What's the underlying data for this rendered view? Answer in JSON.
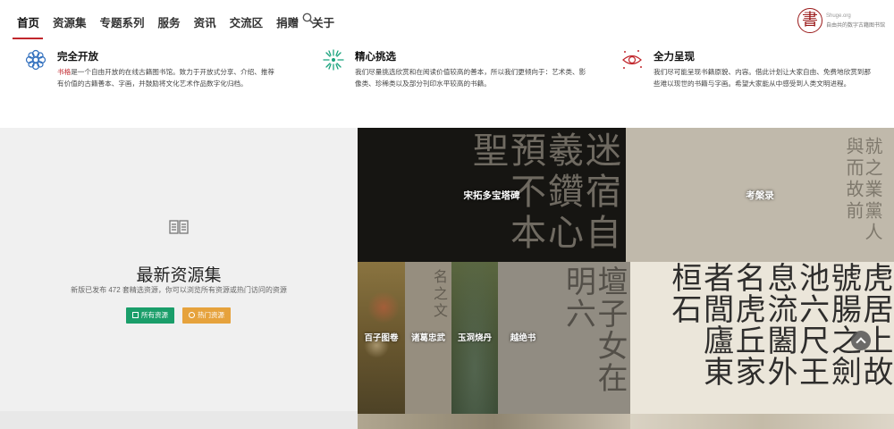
{
  "nav": {
    "items": [
      "首页",
      "资源集",
      "专题系列",
      "服务",
      "资讯",
      "交流区",
      "捐赠",
      "关于"
    ],
    "active_index": 0
  },
  "logo": {
    "seal": "書",
    "line1": "Shuge.org",
    "line2": "自由共的数字古籍图书馆"
  },
  "features": [
    {
      "title": "完全开放",
      "brand": "书格",
      "desc": "是一个自由开放的在线古籍图书馆。致力于开放式分享、介绍、推荐有价值的古籍善本、字画，并鼓励将文化艺术作品数字化归档。",
      "icon": "flower-icon",
      "color": "#2f6ebd"
    },
    {
      "title": "精心挑选",
      "desc": "我们尽量挑选欣赏和在阅读价值较高的善本，所以我们更倾向于：艺术类、影像类、珍稀类以及部分刊印水平较高的书籍。",
      "icon": "burst-icon",
      "color": "#19a37d"
    },
    {
      "title": "全力呈现",
      "desc": "我们尽可能呈现书籍原貌、内容。借此计划让大家自由、免费地欣赏到那些难以现世的书籍与字画。希望大家能从中感受到人类文明进程。",
      "icon": "eye-icon",
      "color": "#c1272d"
    }
  ],
  "latest": {
    "title": "最新资源集",
    "subtitle": "新版已发布 472 套精选资源，你可以浏览所有资源或热门访问的资源",
    "btn_all": "所有资源",
    "btn_hot": "热门资源"
  },
  "tiles": [
    {
      "label": "宋拓多宝塔碑",
      "chars": "迷宿自羲鑽心預不本聖"
    },
    {
      "label": "考槃录",
      "chars": "就之業黨人與而故前"
    },
    {
      "label": "百子图卷",
      "chars": ""
    },
    {
      "label": "诸葛忠武",
      "chars": "名之文"
    },
    {
      "label": "玉洞烧丹",
      "chars": ""
    },
    {
      "label": "越绝书",
      "chars": "壇子女在明六"
    },
    {
      "label": "",
      "chars": "虎居上故號腸之劍池六尺王息流闔外名虎丘家者閭廬東桓石"
    }
  ],
  "colors": {
    "accent": "#c1272d",
    "green_button": "#1a9e6a",
    "orange_button": "#e6a23c"
  }
}
